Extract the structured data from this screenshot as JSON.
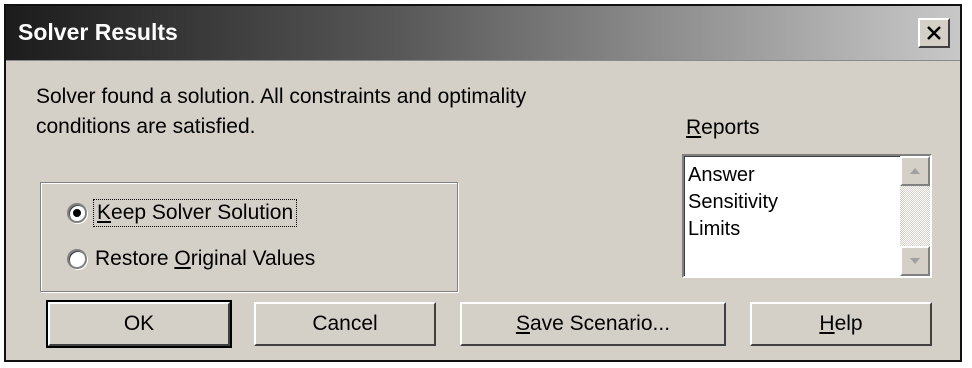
{
  "window": {
    "title": "Solver Results",
    "message_line1": "Solver found a solution.  All constraints and optimality",
    "message_line2": "conditions are satisfied."
  },
  "options": [
    {
      "label_pre": "",
      "label_key": "K",
      "label_post": "eep Solver Solution",
      "selected": true
    },
    {
      "label_pre": "Restore ",
      "label_key": "O",
      "label_post": "riginal Values",
      "selected": false
    }
  ],
  "reports": {
    "label_key": "R",
    "label_post": "eports",
    "items": [
      "Answer",
      "Sensitivity",
      "Limits"
    ]
  },
  "buttons": {
    "ok": "OK",
    "cancel": "Cancel",
    "save_key": "S",
    "save_post": "ave Scenario...",
    "help_key": "H",
    "help_post": "elp"
  },
  "icons": {
    "close": "close-icon",
    "scroll_up": "arrow-up-icon",
    "scroll_down": "arrow-down-icon"
  }
}
